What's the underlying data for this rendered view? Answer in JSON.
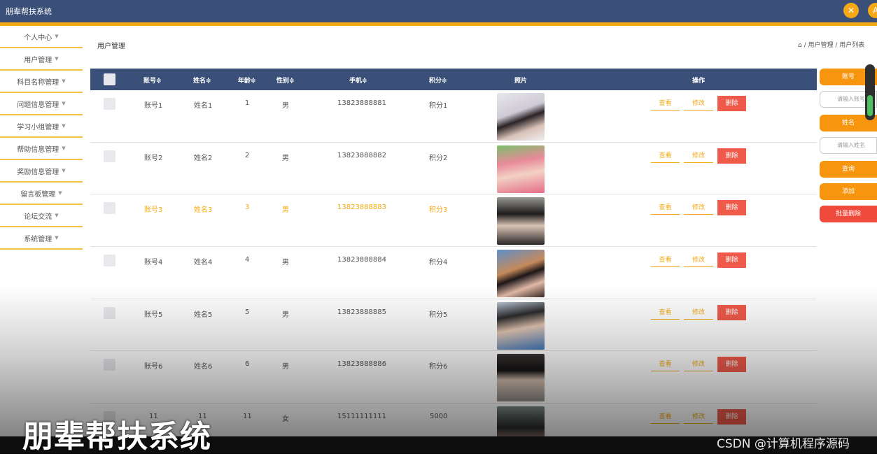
{
  "app": {
    "title": "朋辈帮扶系统"
  },
  "sidebar": {
    "items": [
      {
        "label": "个人中心"
      },
      {
        "label": "用户管理"
      },
      {
        "label": "科目名称管理"
      },
      {
        "label": "问题信息管理"
      },
      {
        "label": "学习小组管理"
      },
      {
        "label": "帮助信息管理"
      },
      {
        "label": "奖励信息管理"
      },
      {
        "label": "留言板管理"
      },
      {
        "label": "论坛交流"
      },
      {
        "label": "系统管理"
      }
    ]
  },
  "page": {
    "title": "用户管理",
    "breadcrumb": "⌂ / 用户管理 / 用户列表"
  },
  "table": {
    "headers": {
      "account": "账号≑",
      "name": "姓名≑",
      "age": "年龄≑",
      "gender": "性别≑",
      "phone": "手机≑",
      "points": "积分≑",
      "photo": "照片",
      "actions": "操作"
    },
    "view_label": "查看",
    "edit_label": "修改",
    "delete_label": "删除",
    "rows": [
      {
        "account": "账号1",
        "name": "姓名1",
        "age": "1",
        "gender": "男",
        "phone": "13823888881",
        "points": "积分1"
      },
      {
        "account": "账号2",
        "name": "姓名2",
        "age": "2",
        "gender": "男",
        "phone": "13823888882",
        "points": "积分2"
      },
      {
        "account": "账号3",
        "name": "姓名3",
        "age": "3",
        "gender": "男",
        "phone": "13823888883",
        "points": "积分3"
      },
      {
        "account": "账号4",
        "name": "姓名4",
        "age": "4",
        "gender": "男",
        "phone": "13823888884",
        "points": "积分4"
      },
      {
        "account": "账号5",
        "name": "姓名5",
        "age": "5",
        "gender": "男",
        "phone": "13823888885",
        "points": "积分5"
      },
      {
        "account": "账号6",
        "name": "姓名6",
        "age": "6",
        "gender": "男",
        "phone": "13823888886",
        "points": "积分6"
      },
      {
        "account": "11",
        "name": "11",
        "age": "11",
        "gender": "女",
        "phone": "15111111111",
        "points": "5000"
      }
    ]
  },
  "search": {
    "account_label": "账号",
    "account_placeholder": "请输入账号",
    "name_label": "姓名",
    "name_placeholder": "请输入姓名",
    "query_label": "查询",
    "add_label": "添加",
    "batch_delete_label": "批量删除"
  },
  "watermark": {
    "title": "朋辈帮扶系统",
    "csdn": "CSDN @计算机程序源码"
  },
  "colors": {
    "header": "#3b5078",
    "accent": "#f5a915",
    "danger": "#f05a4a"
  }
}
